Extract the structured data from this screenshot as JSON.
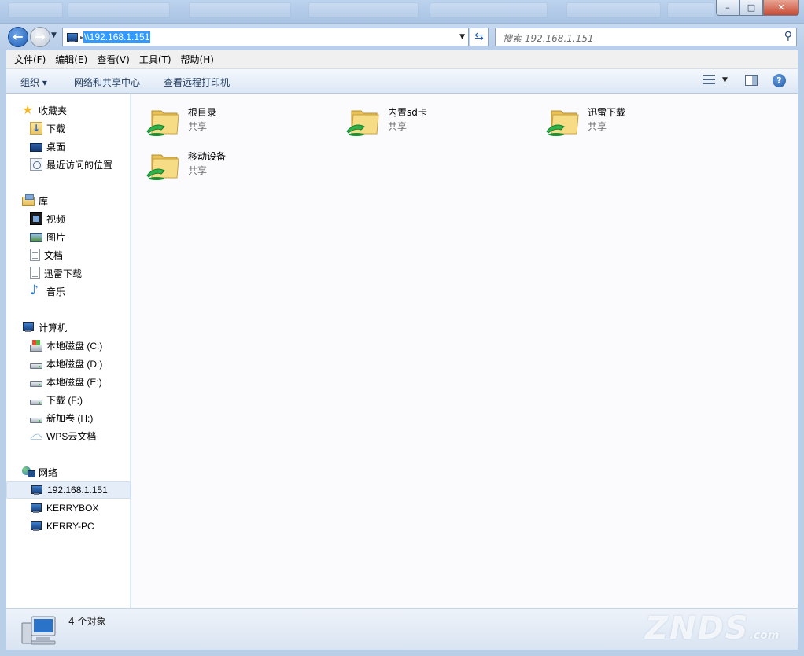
{
  "window": {
    "minimize_glyph": "–",
    "maximize_glyph": "□",
    "close_glyph": "✕"
  },
  "navigation": {
    "address_path": "\\\\192.168.1.151",
    "search_placeholder": "搜索 192.168.1.151"
  },
  "menu": {
    "items": [
      "文件(F)",
      "编辑(E)",
      "查看(V)",
      "工具(T)",
      "帮助(H)"
    ]
  },
  "toolbar": {
    "organize": "组织 ▾",
    "network_center": "网络和共享中心",
    "view_printers": "查看远程打印机",
    "help_glyph": "?"
  },
  "sidebar": {
    "favorites": {
      "label": "收藏夹",
      "items": [
        "下载",
        "桌面",
        "最近访问的位置"
      ]
    },
    "libraries": {
      "label": "库",
      "items": [
        "视频",
        "图片",
        "文档",
        "迅雷下载",
        "音乐"
      ]
    },
    "computer": {
      "label": "计算机",
      "items": [
        "本地磁盘 (C:)",
        "本地磁盘 (D:)",
        "本地磁盘 (E:)",
        "下载 (F:)",
        "新加卷 (H:)",
        "WPS云文档"
      ]
    },
    "network": {
      "label": "网络",
      "items": [
        "192.168.1.151",
        "KERRYBOX",
        "KERRY-PC"
      ]
    }
  },
  "content": {
    "items": [
      {
        "name": "根目录",
        "type": "共享"
      },
      {
        "name": "内置sd卡",
        "type": "共享"
      },
      {
        "name": "迅雷下载",
        "type": "共享"
      },
      {
        "name": "移动设备",
        "type": "共享"
      }
    ]
  },
  "status": {
    "count_text": "4 个对象",
    "watermark": "ZNDS",
    "watermark_suffix": ".com"
  },
  "colors": {
    "selection": "#3399ff",
    "folder": "#f3d27a",
    "share_badge": "#2fb24a"
  }
}
